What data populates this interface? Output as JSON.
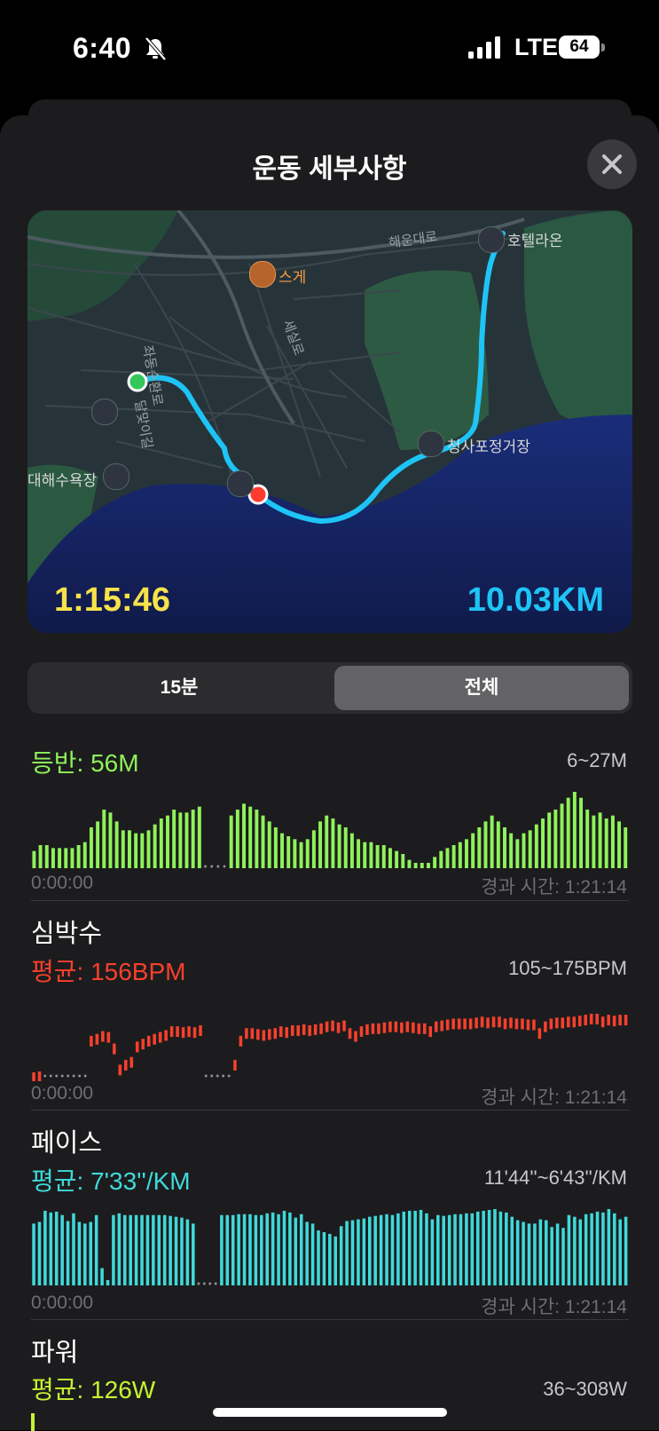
{
  "status_bar": {
    "time": "6:40",
    "network": "LTE",
    "battery": "64"
  },
  "sheet": {
    "title": "운동 세부사항"
  },
  "map": {
    "labels": {
      "haeundae_ro": "해운대로",
      "hotel": "호텔라온",
      "sge": "스게",
      "jwadong": "좌동순환로",
      "sesil": "세실로",
      "dalmaji": "달맞이길",
      "beach": "대해수욕장",
      "bus_stop": "청사포정거장"
    },
    "duration": "1:15:46",
    "distance": "10.03KM"
  },
  "segment": {
    "options": [
      "15분",
      "전체"
    ],
    "selected": "전체"
  },
  "metrics": {
    "elevation": {
      "avg": "등반: 56M",
      "range": "6~27M",
      "axis_start": "0:00:00",
      "axis_end": "경과 시간: 1:21:14",
      "color": "#8ff25a",
      "values": [
        6,
        8,
        8,
        7,
        7,
        7,
        7,
        8,
        9,
        14,
        16,
        20,
        19,
        16,
        13,
        13,
        12,
        12,
        13,
        15,
        17,
        18,
        20,
        19,
        19,
        20,
        21,
        null,
        null,
        null,
        null,
        18,
        20,
        22,
        21,
        20,
        18,
        16,
        14,
        12,
        11,
        10,
        9,
        10,
        13,
        16,
        18,
        17,
        15,
        14,
        12,
        10,
        9,
        9,
        8,
        8,
        7,
        6,
        5,
        3,
        2,
        2,
        2,
        4,
        6,
        7,
        8,
        9,
        10,
        12,
        14,
        16,
        18,
        16,
        14,
        12,
        10,
        12,
        13,
        15,
        17,
        19,
        20,
        22,
        24,
        26,
        24,
        20,
        18,
        19,
        17,
        18,
        16,
        14
      ]
    },
    "heart_rate": {
      "title": "심박수",
      "avg": "평균: 156BPM",
      "range": "105~175BPM",
      "axis_start": "0:00:00",
      "axis_end": "경과 시간: 1:21:14",
      "color": "#f6402c",
      "values": [
        112,
        113,
        null,
        null,
        null,
        null,
        null,
        null,
        null,
        null,
        150,
        152,
        155,
        154,
        142,
        120,
        125,
        128,
        144,
        147,
        150,
        152,
        154,
        156,
        160,
        160,
        159,
        160,
        159,
        161,
        null,
        null,
        null,
        null,
        null,
        125,
        150,
        158,
        158,
        157,
        156,
        157,
        158,
        160,
        159,
        161,
        161,
        162,
        161,
        162,
        163,
        165,
        166,
        164,
        166,
        158,
        155,
        160,
        162,
        163,
        163,
        164,
        165,
        165,
        164,
        165,
        164,
        163,
        163,
        160,
        165,
        166,
        167,
        168,
        168,
        168,
        168,
        169,
        170,
        169,
        170,
        170,
        168,
        169,
        168,
        168,
        167,
        167,
        158,
        165,
        168,
        169,
        169,
        170,
        170,
        171,
        172,
        173,
        173,
        170,
        172,
        171,
        172,
        172
      ]
    },
    "pace": {
      "title": "페이스",
      "avg": "평균: 7'33''/KM",
      "range": "11'44''~6'43''/KM",
      "axis_start": "0:00:00",
      "axis_end": "경과 시간: 1:21:14",
      "color": "#40d9d9",
      "values": [
        70,
        72,
        85,
        83,
        84,
        80,
        73,
        82,
        72,
        70,
        72,
        80,
        18,
        4,
        80,
        82,
        80,
        80,
        80,
        80,
        80,
        80,
        80,
        80,
        79,
        78,
        77,
        75,
        70,
        null,
        null,
        null,
        null,
        80,
        80,
        80,
        81,
        81,
        81,
        80,
        80,
        82,
        83,
        81,
        85,
        83,
        77,
        81,
        72,
        70,
        62,
        60,
        58,
        55,
        67,
        73,
        74,
        75,
        76,
        78,
        79,
        80,
        81,
        80,
        82,
        84,
        85,
        85,
        86,
        82,
        75,
        80,
        79,
        80,
        81,
        81,
        82,
        82,
        84,
        85,
        86,
        87,
        84,
        83,
        78,
        74,
        72,
        70,
        70,
        75,
        74,
        66,
        70,
        65,
        80,
        78,
        75,
        81,
        82,
        84,
        83,
        87,
        82,
        75,
        78
      ]
    },
    "power": {
      "title": "파워",
      "avg": "평균: 126W",
      "range": "36~308W",
      "color": "#c6f233"
    }
  }
}
